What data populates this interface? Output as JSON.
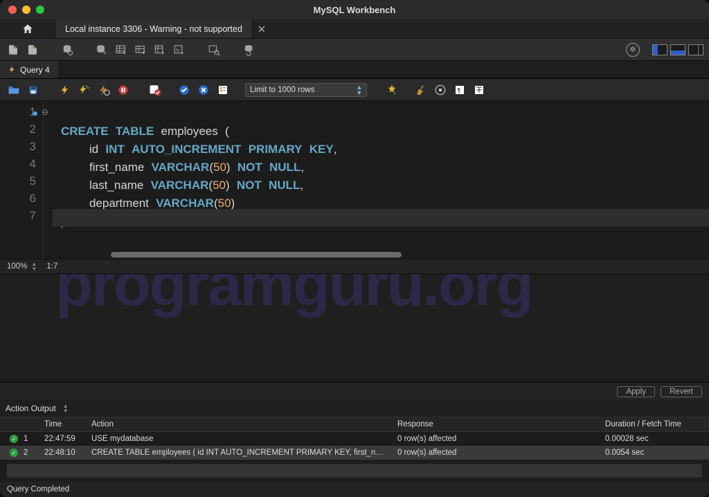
{
  "title": "MySQL Workbench",
  "connection_tab": "Local instance 3306 - Warning - not supported",
  "query_tab": "Query 4",
  "limit_label": "Limit to 1000 rows",
  "zoom": "100%",
  "cursor_pos": "1:7",
  "watermark": "programguru.org",
  "buttons": {
    "apply": "Apply",
    "revert": "Revert"
  },
  "action_output_label": "Action Output",
  "columns": {
    "time": "Time",
    "action": "Action",
    "response": "Response",
    "duration": "Duration / Fetch Time"
  },
  "rows": [
    {
      "no": "1",
      "time": "22:47:59",
      "action": "USE mydatabase",
      "response": "0 row(s) affected",
      "duration": "0.00028 sec"
    },
    {
      "no": "2",
      "time": "22:48:10",
      "action": "CREATE TABLE employees (     id INT AUTO_INCREMENT PRIMARY KEY,     first_n…",
      "response": "0 row(s) affected",
      "duration": "0.0054 sec"
    }
  ],
  "footer": "Query Completed",
  "sql": {
    "l1a": "CREATE",
    "l1b": "TABLE",
    "l1c": "employees",
    "l1d": "(",
    "l2a": "id",
    "l2b": "INT",
    "l2c": "AUTO_INCREMENT",
    "l2d": "PRIMARY",
    "l2e": "KEY",
    "l2f": ",",
    "l3a": "first_name",
    "l3b": "VARCHAR",
    "l3c": "(",
    "l3d": "50",
    "l3e": ")",
    "l3f": "NOT",
    "l3g": "NULL",
    "l3h": ",",
    "l4a": "last_name",
    "l4b": "VARCHAR",
    "l4c": "(",
    "l4d": "50",
    "l4e": ")",
    "l4f": "NOT",
    "l4g": "NULL",
    "l4h": ",",
    "l5a": "department",
    "l5b": "VARCHAR",
    "l5c": "(",
    "l5d": "50",
    "l5e": ")",
    "l6": ");"
  }
}
